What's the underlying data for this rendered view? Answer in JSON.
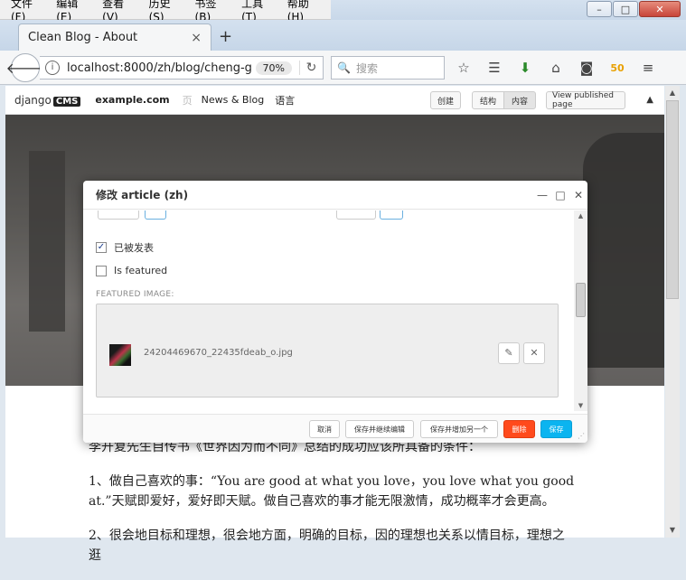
{
  "menu": [
    "文件(F)",
    "编辑(E)",
    "查看(V)",
    "历史(S)",
    "书签(B)",
    "工具(T)",
    "帮助(H)"
  ],
  "window": {
    "minimize": "▭",
    "maximize": "□",
    "close": "✕"
  },
  "tab": {
    "title": "Clean Blog - About",
    "close": "×",
    "new": "+"
  },
  "nav": {
    "url": "localhost:8000/zh/blog/cheng-g",
    "zoom": "70%",
    "search_placeholder": "搜索"
  },
  "cms": {
    "logo": "django",
    "logo_badge": "CMS",
    "site": "example.com",
    "separator": "页",
    "item_news": "News & Blog",
    "item_lang": "语言",
    "btn_create": "创建",
    "btn_structure": "结构",
    "btn_content": "内容",
    "btn_view_published": "View published page"
  },
  "modal": {
    "title": "修改 article (zh)",
    "published_label": "已被发表",
    "featured_label": "Is featured",
    "featured_image_label": "FEATURED IMAGE:",
    "filename": "24204469670_22435fdeab_o.jpg",
    "btn_cancel": "取消",
    "btn_save_continue": "保存并继续编辑",
    "btn_save_add": "保存并增加另一个",
    "btn_delete": "删除",
    "btn_save": "保存"
  },
  "article": {
    "p1": "李开复先生自传书《世界因为而不同》总结的成功应该所具备的条件：",
    "p2": "1、做自己喜欢的事：“You are good at what you love，you love what you good at.”天赋即爱好，爱好即天赋。做自己喜欢的事才能无限激情，成功概率才会更高。",
    "p3": "2、很会地目标和理想，很会地方面，明确的目标，因的理想也关系以情目标，理想之逛"
  },
  "colors": {
    "delete": "#ff4a1c",
    "save": "#0bb4f0"
  }
}
